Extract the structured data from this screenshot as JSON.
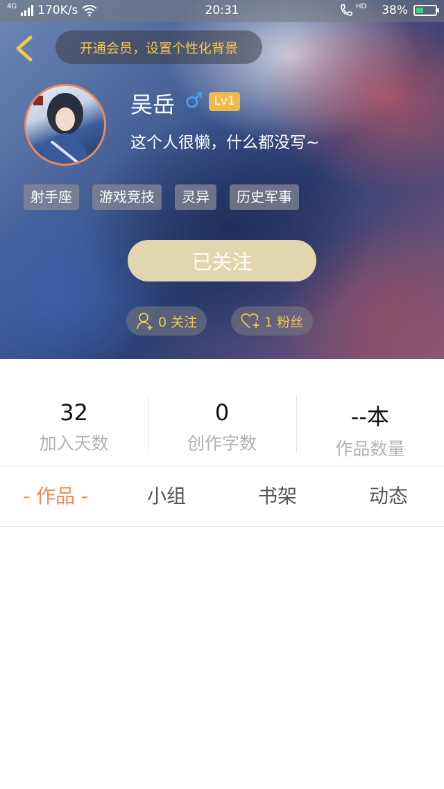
{
  "status_bar": {
    "network_type": "4G",
    "speed": "170K/s",
    "time": "20:31",
    "hd": "HD",
    "battery": "38%",
    "battery_level": 0.38
  },
  "header": {
    "vip_banner": "开通会员，设置个性化背景",
    "username": "吴岳",
    "gender_symbol": "♂",
    "level": "Lv1",
    "bio": "这个人很懒，什么都没写~",
    "tags": [
      "射手座",
      "游戏竞技",
      "灵异",
      "历史军事"
    ],
    "follow_button": "已关注",
    "following": "0 关注",
    "fans": "1 粉丝"
  },
  "stats": [
    {
      "value": "32",
      "label": "加入天数"
    },
    {
      "value": "0",
      "label": "创作字数"
    },
    {
      "value": "--本",
      "label": "作品数量"
    }
  ],
  "tabs": [
    {
      "label": "- 作品 -",
      "active": true
    },
    {
      "label": "小组",
      "active": false
    },
    {
      "label": "书架",
      "active": false
    },
    {
      "label": "动态",
      "active": false
    }
  ],
  "colors": {
    "accent": "#f08a50",
    "gold": "#f2c94c",
    "follow_button": "#e2d6ae",
    "level_badge": "#f2b84b"
  }
}
